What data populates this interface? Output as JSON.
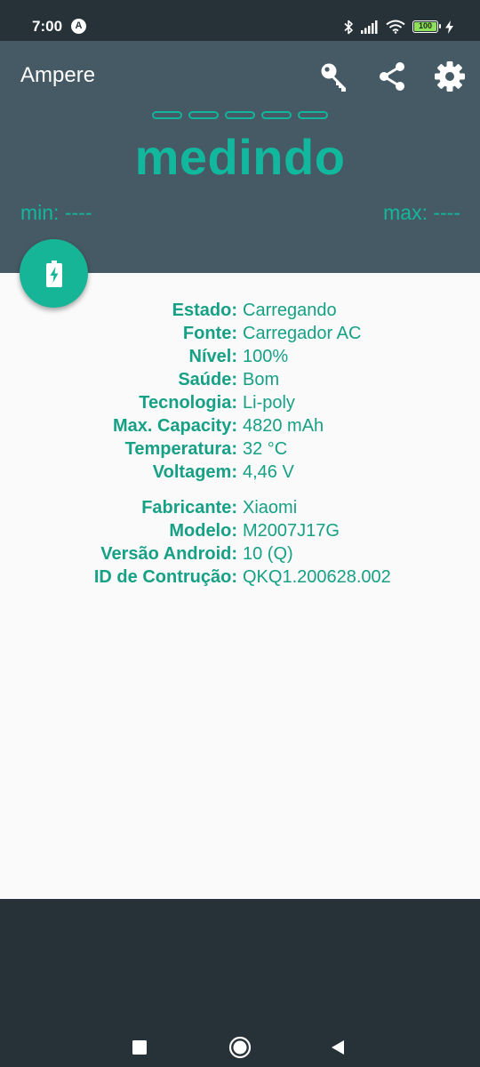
{
  "status_bar": {
    "time": "7:00",
    "a_badge": "A",
    "battery_level": "100"
  },
  "app": {
    "title": "Ampere"
  },
  "toolbar": {
    "icons": [
      "key-icon",
      "share-icon",
      "gear-icon"
    ]
  },
  "meter": {
    "segments": 5,
    "reading": "medindo",
    "min": "min: ----",
    "max": "max: ----"
  },
  "fab": {
    "icon": "battery-charging-icon"
  },
  "battery_info": [
    {
      "label": "Estado:",
      "value": "Carregando"
    },
    {
      "label": "Fonte:",
      "value": "Carregador AC"
    },
    {
      "label": "Nível:",
      "value": "100%"
    },
    {
      "label": "Saúde:",
      "value": "Bom"
    },
    {
      "label": "Tecnologia:",
      "value": "Li-poly"
    },
    {
      "label": "Max. Capacity:",
      "value": "4820 mAh"
    },
    {
      "label": "Temperatura:",
      "value": "32 °C"
    },
    {
      "label": "Voltagem:",
      "value": "4,46 V"
    }
  ],
  "device_info": [
    {
      "label": "Fabricante:",
      "value": "Xiaomi"
    },
    {
      "label": "Modelo:",
      "value": "M2007J17G"
    },
    {
      "label": "Versão Android:",
      "value": "10 (Q)"
    },
    {
      "label": "ID de Contrução:",
      "value": "QKQ1.200628.002"
    }
  ],
  "colors": {
    "accent": "#16b598",
    "header": "#455a64",
    "status_bar": "#263238",
    "text_accent": "#16a085"
  },
  "nav": {
    "icons": [
      "recents-icon",
      "home-icon",
      "back-icon"
    ]
  }
}
